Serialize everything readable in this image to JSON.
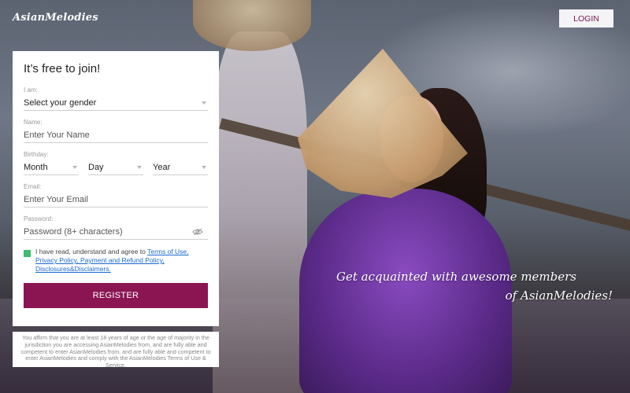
{
  "header": {
    "logo_text": "AsianMelodies",
    "login_label": "LOGIN"
  },
  "form": {
    "title": "It’s free to join!",
    "gender": {
      "label": "I am:",
      "value": "Select your gender"
    },
    "name": {
      "label": "Name:",
      "placeholder": "Enter Your Name"
    },
    "birthday": {
      "label": "Birthday:",
      "month": "Month",
      "day": "Day",
      "year": "Year"
    },
    "email": {
      "label": "Email:",
      "placeholder": "Enter Your Email"
    },
    "password": {
      "label": "Password:",
      "placeholder": "Password (8+ characters)"
    },
    "terms": {
      "prefix": "I have read, understand and agree to ",
      "link1": "Terms of Use, Privacy Policy, Payment and Refund Policy, Disclosures&Disclaimers."
    },
    "register_label": "REGISTER"
  },
  "disclaimer": "You affirm that you are at least 18 years of age or the age of majority in the jurisdiction you are accessing AsianMelodies from, and are fully able and competent to enter AsianMelodies from, and are fully able and competent to enter AsianMelodies and comply with the AsianMelodies Terms of Use & Service.",
  "tagline": {
    "line1": "Get acquainted with awesome members",
    "line2": "of AsianMelodies!"
  },
  "colors": {
    "accent": "#8b1553",
    "checkbox": "#3dbc6e",
    "link": "#1a6ad0"
  }
}
